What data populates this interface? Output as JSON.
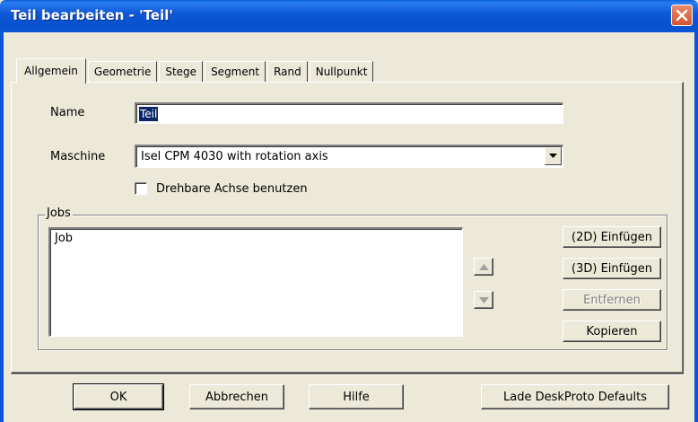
{
  "window": {
    "title": "Teil bearbeiten  - 'Teil'",
    "close_icon": "close-icon"
  },
  "tabs": [
    {
      "label": "Allgemein",
      "active": true
    },
    {
      "label": "Geometrie",
      "active": false
    },
    {
      "label": "Stege",
      "active": false
    },
    {
      "label": "Segment",
      "active": false
    },
    {
      "label": "Rand",
      "active": false
    },
    {
      "label": "Nullpunkt",
      "active": false
    }
  ],
  "form": {
    "name_label": "Name",
    "name_value": "Teil",
    "machine_label": "Maschine",
    "machine_value": "Isel CPM 4030 with rotation axis",
    "rotary_checkbox_label": "Drehbare Achse benutzen",
    "rotary_checked": false
  },
  "jobs": {
    "group_label": "Jobs",
    "items": [
      "Job"
    ],
    "insert_2d": "(2D) Einfügen",
    "insert_3d": "(3D) Einfügen",
    "remove": "Entfernen",
    "copy": "Kopieren"
  },
  "footer": {
    "ok": "OK",
    "cancel": "Abbrechen",
    "help": "Hilfe",
    "defaults": "Lade DeskProto Defaults"
  },
  "colors": {
    "titlebar": "#0b56d6",
    "face": "#ece9d8",
    "selection": "#0a246a"
  }
}
